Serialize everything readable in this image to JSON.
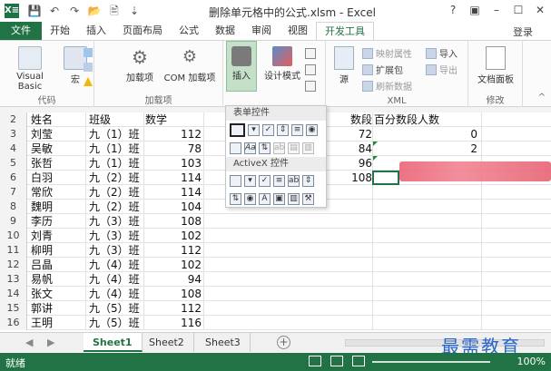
{
  "titlebar": {
    "app_icon": "X≡",
    "title": "删除单元格中的公式.xlsm - Excel",
    "help": "?",
    "ribbon_opts": "▣",
    "minimize": "–",
    "maximize": "☐",
    "close": "✕"
  },
  "tabs": [
    "文件",
    "开始",
    "插入",
    "页面布局",
    "公式",
    "数据",
    "审阅",
    "视图",
    "开发工具"
  ],
  "login_label": "登录",
  "ribbon": {
    "code": {
      "visual_basic": "Visual Basic",
      "macro": "宏",
      "label": "代码"
    },
    "addins": {
      "addins": "加载项",
      "com": "COM 加载项",
      "label": "加载项"
    },
    "controls": {
      "insert": "插入",
      "design_mode": "设计模式"
    },
    "xml": {
      "source": "源",
      "map_props": "映射属性",
      "expansion": "扩展包",
      "refresh": "刷新数据",
      "import": "导入",
      "export": "导出",
      "label": "XML"
    },
    "modify": {
      "doc_panel": "文档面板",
      "label": "修改"
    }
  },
  "dropdown": {
    "form_header": "表单控件",
    "activex_header": "ActiveX 控件"
  },
  "header_row": {
    "row_number": "2",
    "name": "姓名",
    "class": "班级",
    "score": "数学",
    "col_e": "数段",
    "col_f": "百分数段人数"
  },
  "rows": [
    {
      "num": "3",
      "name": "刘莹",
      "class": "九（1）班",
      "score": "112",
      "e": "72",
      "f": "0"
    },
    {
      "num": "4",
      "name": "吴敏",
      "class": "九（1）班",
      "score": "78",
      "e": "84",
      "f": "2"
    },
    {
      "num": "5",
      "name": "张哲",
      "class": "九（1）班",
      "score": "103",
      "e": "96",
      "f": ""
    },
    {
      "num": "6",
      "name": "白羽",
      "class": "九（2）班",
      "score": "114",
      "e": "108",
      "f": ""
    },
    {
      "num": "7",
      "name": "常欣",
      "class": "九（2）班",
      "score": "114",
      "e": "",
      "f": ""
    },
    {
      "num": "8",
      "name": "魏明",
      "class": "九（2）班",
      "score": "104",
      "e": "",
      "f": ""
    },
    {
      "num": "9",
      "name": "李历",
      "class": "九（3）班",
      "score": "108",
      "e": "",
      "f": ""
    },
    {
      "num": "10",
      "name": "刘青",
      "class": "九（3）班",
      "score": "102",
      "e": "",
      "f": ""
    },
    {
      "num": "11",
      "name": "柳明",
      "class": "九（3）班",
      "score": "112",
      "e": "",
      "f": ""
    },
    {
      "num": "12",
      "name": "吕晶",
      "class": "九（4）班",
      "score": "102",
      "e": "",
      "f": ""
    },
    {
      "num": "13",
      "name": "易帆",
      "class": "九（4）班",
      "score": "94",
      "e": "",
      "f": ""
    },
    {
      "num": "14",
      "name": "张文",
      "class": "九（4）班",
      "score": "108",
      "e": "",
      "f": ""
    },
    {
      "num": "15",
      "name": "郭讲",
      "class": "九（5）班",
      "score": "112",
      "e": "",
      "f": ""
    },
    {
      "num": "16",
      "name": "王明",
      "class": "九（5）班",
      "score": "116",
      "e": "",
      "f": ""
    }
  ],
  "sheets": [
    "Sheet1",
    "Sheet2",
    "Sheet3"
  ],
  "status": {
    "ready": "就绪",
    "zoom": "100%"
  },
  "watermark": "最需教育",
  "colors": {
    "excel_green": "#217346",
    "highlight": "#c5e0c8"
  }
}
